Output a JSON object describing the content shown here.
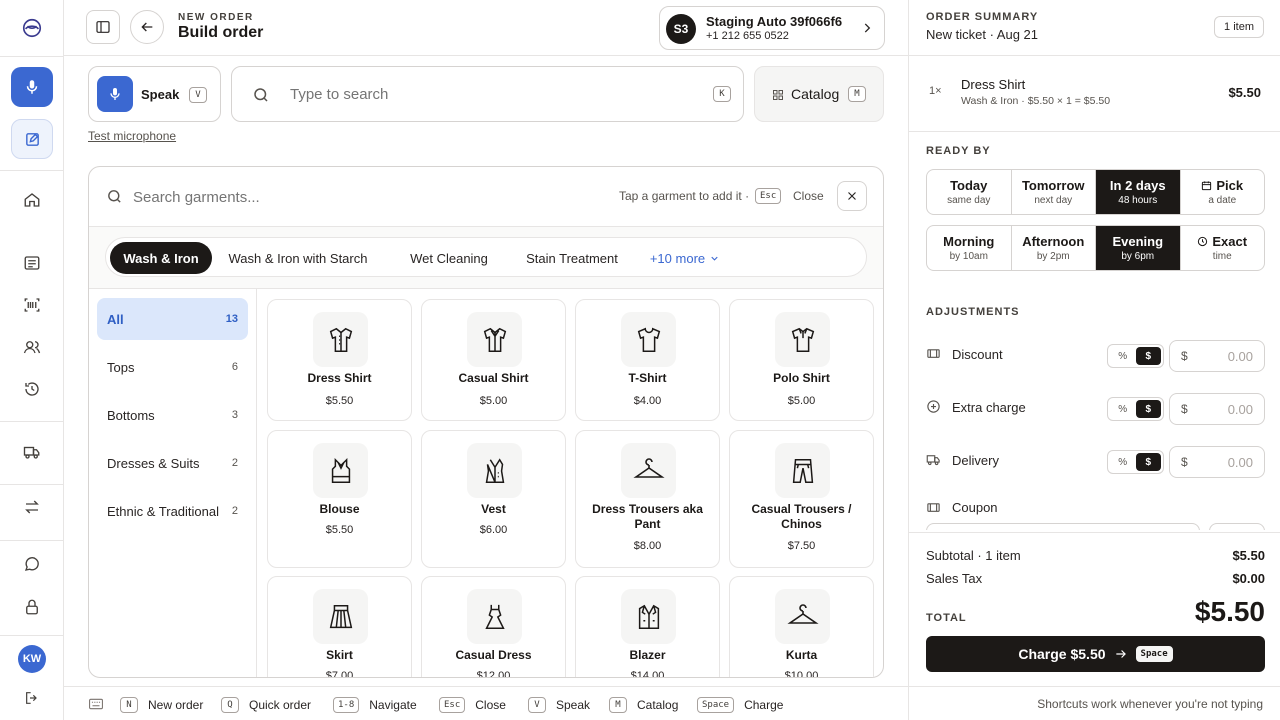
{
  "header": {
    "eyebrow": "NEW ORDER",
    "title": "Build order",
    "customer": {
      "initials": "S3",
      "name": "Staging Auto 39f066f6",
      "phone": "+1 212 655 0522"
    }
  },
  "input_row": {
    "speak_label": "Speak",
    "speak_key": "V",
    "search_placeholder": "Type to search",
    "search_key": "K",
    "catalog_label": "Catalog",
    "catalog_key": "M",
    "test_mic": "Test microphone"
  },
  "garments": {
    "search_placeholder": "Search garments...",
    "hint": "Tap a garment to add it ·",
    "esc_key": "Esc",
    "close_label": "Close",
    "services": [
      "Wash & Iron",
      "Wash & Iron with Starch",
      "Wet Cleaning",
      "Stain Treatment"
    ],
    "more_label": "+10 more",
    "active_service": "Wash & Iron",
    "categories": [
      {
        "label": "All",
        "count": "13",
        "active": true
      },
      {
        "label": "Tops",
        "count": "6"
      },
      {
        "label": "Bottoms",
        "count": "3"
      },
      {
        "label": "Dresses & Suits",
        "count": "2"
      },
      {
        "label": "Ethnic & Traditional",
        "count": "2"
      }
    ],
    "items": [
      {
        "name": "Dress Shirt",
        "price": "$5.50",
        "icon": "dress-shirt-icon"
      },
      {
        "name": "Casual Shirt",
        "price": "$5.00",
        "icon": "casual-shirt-icon"
      },
      {
        "name": "T-Shirt",
        "price": "$4.00",
        "icon": "t-shirt-icon"
      },
      {
        "name": "Polo Shirt",
        "price": "$5.00",
        "icon": "polo-shirt-icon"
      },
      {
        "name": "Blouse",
        "price": "$5.50",
        "icon": "blouse-icon"
      },
      {
        "name": "Vest",
        "price": "$6.00",
        "icon": "vest-icon"
      },
      {
        "name": "Dress Trousers aka Pant",
        "price": "$8.00",
        "icon": "hanger-icon"
      },
      {
        "name": "Casual Trousers / Chinos",
        "price": "$7.50",
        "icon": "trousers-icon"
      },
      {
        "name": "Skirt",
        "price": "$7.00",
        "icon": "skirt-icon"
      },
      {
        "name": "Casual Dress",
        "price": "$12.00",
        "icon": "dress-icon"
      },
      {
        "name": "Blazer",
        "price": "$14.00",
        "icon": "blazer-icon"
      },
      {
        "name": "Kurta",
        "price": "$10.00",
        "icon": "hanger-icon"
      }
    ]
  },
  "summary": {
    "heading": "ORDER SUMMARY",
    "subtitle": "New ticket · Aug 21",
    "count_badge": "1 item",
    "line": {
      "qty": "1×",
      "name": "Dress Shirt",
      "detail": "Wash & Iron · $5.50 × 1 = $5.50",
      "price": "$5.50"
    },
    "ready_by_heading": "READY BY",
    "ready_days": [
      {
        "title": "Today",
        "sub": "same day"
      },
      {
        "title": "Tomorrow",
        "sub": "next day"
      },
      {
        "title": "In 2 days",
        "sub": "48 hours",
        "active": true
      },
      {
        "title": "Pick",
        "sub": "a date",
        "icon": "calendar-icon"
      }
    ],
    "ready_times": [
      {
        "title": "Morning",
        "sub": "by 10am"
      },
      {
        "title": "Afternoon",
        "sub": "by 2pm"
      },
      {
        "title": "Evening",
        "sub": "by 6pm",
        "active": true
      },
      {
        "title": "Exact",
        "sub": "time",
        "icon": "clock-icon"
      }
    ],
    "adjustments_heading": "ADJUSTMENTS",
    "adjustments": [
      {
        "label": "Discount",
        "pct": "%",
        "dollar": "$",
        "currency": "$",
        "value": "0.00",
        "icon": "discount-icon"
      },
      {
        "label": "Extra charge",
        "pct": "%",
        "dollar": "$",
        "currency": "$",
        "value": "0.00",
        "icon": "plus-circle-icon"
      },
      {
        "label": "Delivery",
        "pct": "%",
        "dollar": "$",
        "currency": "$",
        "value": "0.00",
        "icon": "truck-icon"
      }
    ],
    "coupon_label": "Coupon",
    "subtotal_label": "Subtotal · 1 item",
    "subtotal": "$5.50",
    "tax_label": "Sales Tax",
    "tax": "$0.00",
    "total_label": "TOTAL",
    "total": "$5.50",
    "charge_label": "Charge $5.50",
    "charge_key": "Space"
  },
  "footer": {
    "shortcuts": [
      {
        "key": "N",
        "label": "New order"
      },
      {
        "key": "Q",
        "label": "Quick order"
      },
      {
        "key": "1-8",
        "label": "Navigate"
      },
      {
        "key": "Esc",
        "label": "Close"
      },
      {
        "key": "V",
        "label": "Speak"
      },
      {
        "key": "M",
        "label": "Catalog"
      },
      {
        "key": "Space",
        "label": "Charge"
      }
    ],
    "note": "Shortcuts work whenever you're not typing"
  },
  "rail": {
    "avatar": "KW"
  },
  "colors": {
    "accent": "#3b68d1",
    "dark": "#1c1917",
    "active_bg": "#dbe7fb"
  }
}
